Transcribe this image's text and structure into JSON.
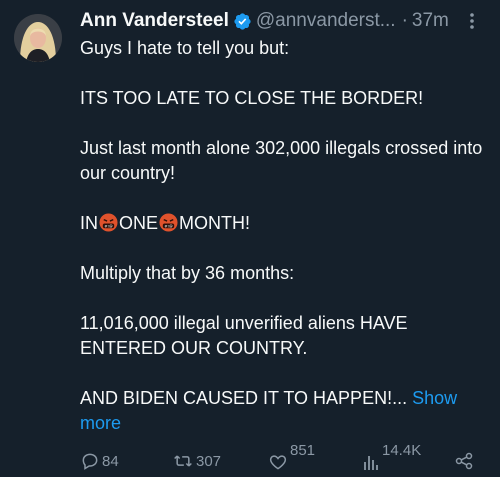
{
  "author": {
    "name": "Ann Vandersteel",
    "handle": "@annvanderst...",
    "time": "37m",
    "separator": "·"
  },
  "icons": {
    "verified": "verified-badge-icon",
    "more": "more-options-icon",
    "emoji": "face-with-symbols-on-mouth-emoji",
    "reply": "reply-icon",
    "retweet": "retweet-icon",
    "like": "heart-icon",
    "views": "views-bar-chart-icon",
    "share": "share-icon"
  },
  "colors": {
    "background": "#15202b",
    "text": "#f7f9f9",
    "secondary": "#8b98a5",
    "link": "#1d9bf0",
    "verified": "#1d9bf0"
  },
  "post": {
    "line1": "Guys I hate to tell you but:",
    "line2": "ITS TOO LATE TO CLOSE THE BORDER!",
    "line3": "Just last month alone 302,000 illegals crossed into our country!",
    "line4_part1": "IN",
    "line4_part2": "ONE",
    "line4_part3": "MONTH!",
    "line5": "Multiply that by 36 months:",
    "line6": "11,016,000 illegal unverified aliens HAVE ENTERED OUR COUNTRY.",
    "line7": "AND BIDEN CAUSED IT TO HAPPEN!...",
    "show_more": "Show more"
  },
  "actions": {
    "replies": "84",
    "retweets": "307",
    "likes": "851",
    "views": "14.4K"
  }
}
